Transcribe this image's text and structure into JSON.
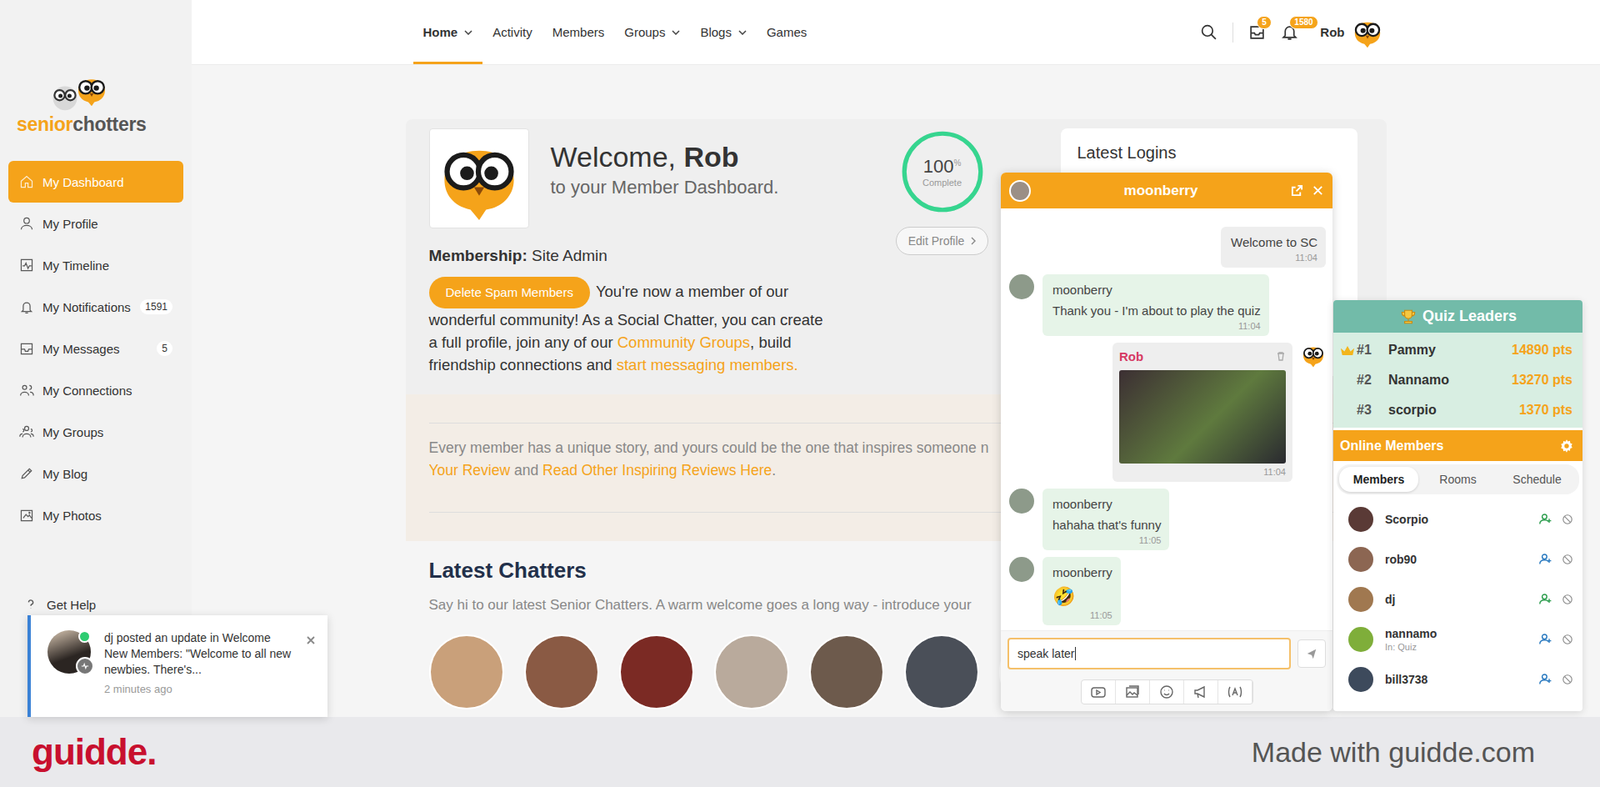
{
  "logo": {
    "first": "senior",
    "second": "chotters"
  },
  "sidebar": {
    "items": [
      {
        "label": "My Dashboard",
        "selected": true,
        "badge": ""
      },
      {
        "label": "My Profile",
        "selected": false,
        "badge": ""
      },
      {
        "label": "My Timeline",
        "selected": false,
        "badge": ""
      },
      {
        "label": "My Notifications",
        "selected": false,
        "badge": "1591"
      },
      {
        "label": "My Messages",
        "selected": false,
        "badge": "5"
      },
      {
        "label": "My Connections",
        "selected": false,
        "badge": ""
      },
      {
        "label": "My Groups",
        "selected": false,
        "badge": ""
      },
      {
        "label": "My Blog",
        "selected": false,
        "badge": ""
      },
      {
        "label": "My Photos",
        "selected": false,
        "badge": ""
      }
    ],
    "help": "Get Help"
  },
  "topnav": {
    "items": [
      {
        "label": "Home",
        "selected": true,
        "dropdown": true
      },
      {
        "label": "Activity",
        "selected": false,
        "dropdown": false
      },
      {
        "label": "Members",
        "selected": false,
        "dropdown": false
      },
      {
        "label": "Groups",
        "selected": false,
        "dropdown": true
      },
      {
        "label": "Blogs",
        "selected": false,
        "dropdown": true
      },
      {
        "label": "Games",
        "selected": false,
        "dropdown": false
      }
    ],
    "messages_badge": "5",
    "notifications_badge": "1580",
    "user": "Rob"
  },
  "welcome": {
    "greeting": "Welcome,",
    "name": "Rob",
    "subtitle": "to your Member Dashboard.",
    "membership_label": "Membership:",
    "membership_value": "Site Admin",
    "spam_button": "Delete Spam Members",
    "intro": [
      {
        "text": "You're now a member of our wonderful community! As a Social Chatter, you can create a full profile, join any of our ",
        "link": false
      },
      {
        "text": "Community Groups",
        "link": true
      },
      {
        "text": ", build friendship connections and ",
        "link": false
      },
      {
        "text": "start messaging members.",
        "link": true
      }
    ]
  },
  "profile": {
    "value": "100",
    "unit": "%",
    "label": "Complete",
    "level": 1,
    "button": "Edit Profile"
  },
  "latest_logins": {
    "title": "Latest Logins"
  },
  "review": {
    "line": "Every member has a unique story, and yours could be the one that inspires someone n",
    "parts": [
      {
        "text": "Your Review",
        "link": true
      },
      {
        "text": " and ",
        "link": false
      },
      {
        "text": "Read Other Inspiring Reviews Here",
        "link": true
      },
      {
        "text": ".",
        "link": false
      }
    ]
  },
  "latest_chatters": {
    "title": "Latest Chatters",
    "subtitle": "Say hi to our latest Senior Chatters. A warm welcome goes a long way - introduce your",
    "avatars": [
      {
        "color": "#c9a07a"
      },
      {
        "color": "#8a5a44"
      },
      {
        "color": "#7b2a24"
      },
      {
        "color": "#b9aa9c"
      },
      {
        "color": "#6d5a4c"
      },
      {
        "color": "#4a4f58"
      },
      {
        "color": "#9fb3c8"
      }
    ]
  },
  "chat": {
    "title": "moonberry",
    "input": "speak later",
    "messages": [
      {
        "own": true,
        "show_header": false,
        "name": "Rob",
        "kind": "text",
        "text": "Welcome to SC",
        "time": "11:04"
      },
      {
        "own": false,
        "show_header": true,
        "name": "moonberry",
        "kind": "text",
        "text": "Thank you - I'm about to play the quiz",
        "time": "11:04"
      },
      {
        "own": true,
        "show_header": true,
        "name": "Rob",
        "kind": "image",
        "text": "",
        "time": "11:04"
      },
      {
        "own": false,
        "show_header": true,
        "name": "moonberry",
        "kind": "text",
        "text": "hahaha that's funny",
        "time": "11:05"
      },
      {
        "own": false,
        "show_header": true,
        "name": "moonberry",
        "kind": "emoji",
        "text": "🤣",
        "time": "11:05"
      }
    ]
  },
  "quiz": {
    "title": "Quiz Leaders",
    "leaders": [
      {
        "rank": "#1",
        "name": "Pammy",
        "points": "14890 pts",
        "crown": true
      },
      {
        "rank": "#2",
        "name": "Nannamo",
        "points": "13270 pts",
        "crown": false
      },
      {
        "rank": "#3",
        "name": "scorpio",
        "points": "1370 pts",
        "crown": false
      }
    ]
  },
  "online": {
    "title": "Online Members",
    "tabs": [
      {
        "label": "Members",
        "selected": true
      },
      {
        "label": "Rooms",
        "selected": false
      },
      {
        "label": "Schedule",
        "selected": false
      }
    ],
    "members": [
      {
        "name": "Scorpio",
        "status": "",
        "friend": true,
        "color": "#5a3a36"
      },
      {
        "name": "rob90",
        "status": "",
        "friend": false,
        "color": "#8c6652"
      },
      {
        "name": "dj",
        "status": "",
        "friend": true,
        "color": "#a07850"
      },
      {
        "name": "nannamo",
        "status": "In: Quiz",
        "friend": false,
        "color": "#7fae3a"
      },
      {
        "name": "bill3738",
        "status": "",
        "friend": false,
        "color": "#3d4a5c"
      }
    ]
  },
  "toast": {
    "text": "dj posted an update in Welcome New Members: \"Welcome to all new newbies. There's...",
    "time": "2 minutes ago",
    "online": true
  },
  "footer": {
    "brand": "guidde.",
    "credit": "Made with guidde.com"
  }
}
